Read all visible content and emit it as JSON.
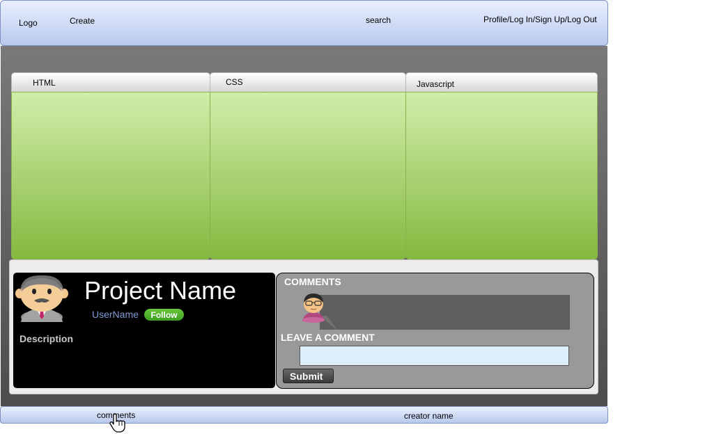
{
  "header": {
    "logo": "Logo",
    "create": "Create",
    "search": "search",
    "account": "Profile/Log In/Sign Up/Log Out"
  },
  "editors": {
    "tabs": [
      {
        "label": "HTML"
      },
      {
        "label": "CSS"
      },
      {
        "label": "Javascript"
      }
    ]
  },
  "project": {
    "name": "Project Name",
    "username": "UserName",
    "follow_label": "Follow",
    "description_label": "Description",
    "avatar_icon": "man-avatar-icon"
  },
  "comments": {
    "title": "COMMENTS",
    "commenter_avatar_icon": "commenter-avatar-icon",
    "leave_comment_label": "LEAVE A COMMENT",
    "input_value": "",
    "submit_label": "Submit"
  },
  "footer": {
    "comments": "comments",
    "creator_name": "creator name",
    "cursor_icon": "hand-pointer-icon"
  },
  "colors": {
    "header_gradient_top": "#e9efff",
    "header_gradient_bottom": "#b9c9ec",
    "editor_green_top": "#d1edaa",
    "editor_green_bottom": "#84b93f",
    "follow_green": "#4cae2c",
    "username_blue": "#7e9bd6",
    "input_bg": "#dbeef9"
  }
}
